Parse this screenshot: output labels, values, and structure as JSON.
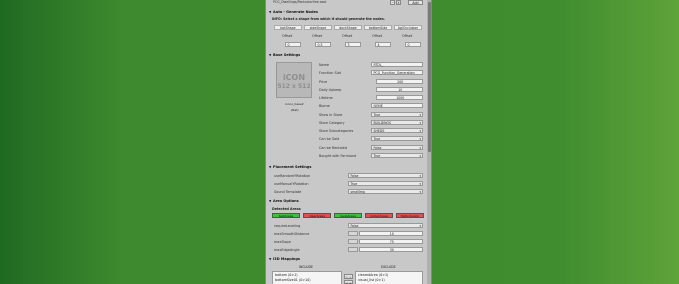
{
  "header": {
    "path": "PCG_Dwellings/Pantcolorfree.asst",
    "btn_minus": "−",
    "btn_x": "X",
    "btn_add": "Add"
  },
  "auto_generate": {
    "title": "Auto - Generate Nodes",
    "info": "INFO: Select a shape from which it should generate the nodes.",
    "columns": [
      "botShape",
      "sideShape",
      "dockShape",
      "bottomSide",
      "AgiOcclusion"
    ],
    "offset_label": "Offset",
    "values": [
      "0",
      "0.5",
      "3",
      "4",
      "0"
    ]
  },
  "base_settings": {
    "title": "Base Settings",
    "icon_text": "iCON",
    "icon_size": "512 x 512",
    "icon_caption": "icono_base2",
    "icon_caption2": "(Nat)",
    "fields": [
      {
        "label": "Name",
        "value": "RTDL_"
      },
      {
        "label": "Function Slot",
        "value": "PCG_Function_Generation"
      },
      {
        "label": "Price",
        "value": "200"
      },
      {
        "label": "Daily Upkeep",
        "value": "10"
      },
      {
        "label": "Lifetime",
        "value": "1000"
      },
      {
        "label": "Biome",
        "value": "NONE"
      }
    ],
    "dropdowns": [
      {
        "label": "Show in Store",
        "value": "True"
      },
      {
        "label": "Store Category",
        "value": "BUILDINGS"
      },
      {
        "label": "Store Subcategories",
        "value": "SHEDS"
      },
      {
        "label": "Can be Sold",
        "value": "True"
      },
      {
        "label": "Can be Rentaled",
        "value": "False"
      },
      {
        "label": "Bought with Farmland",
        "value": "True"
      }
    ]
  },
  "placement_settings": {
    "title": "Placement Settings",
    "rows": [
      {
        "label": "useRandomYRotation",
        "value": "False"
      },
      {
        "label": "useManualYRotation",
        "value": "True"
      },
      {
        "label": "Sound Template",
        "value": "smallImp"
      }
    ]
  },
  "area_options": {
    "title": "Area Options",
    "detected_label": "Detected Areas",
    "buttons": [
      {
        "label": "testAreas",
        "color": "#3fbf3f"
      },
      {
        "label": "clearAreas",
        "color": "#e05050"
      },
      {
        "label": "levelAreas",
        "color": "#3fbf3f"
      },
      {
        "label": "indoorAreas",
        "color": "#e05050"
      },
      {
        "label": "tipOcclusion",
        "color": "#e05050"
      }
    ],
    "rows": [
      {
        "label": "requireLeveling",
        "value": "False"
      },
      {
        "label": "maxSmoothDistance",
        "value": "10"
      },
      {
        "label": "maxSlope",
        "value": "75"
      },
      {
        "label": "maxEdgeAngle",
        "value": "30"
      }
    ]
  },
  "i3d_mappings": {
    "title": "I3D Mappings",
    "include_header": "INCLUDE",
    "exclude_header": "EXCLUDE",
    "include": [
      "bottom (0>1)",
      "bottomSize01 (0>10)"
    ],
    "exclude": [
      "clearedArea (0>1)",
      "visual_list (0>1)"
    ],
    "btn_right": "> >",
    "btn_left": "< <"
  }
}
